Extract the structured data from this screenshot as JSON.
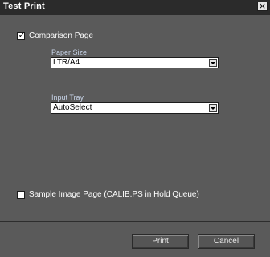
{
  "window": {
    "title": "Test Print",
    "close_glyph": "×"
  },
  "comparison_page": {
    "label": "Comparison Page",
    "checked": true
  },
  "paper_size": {
    "label": "Paper Size",
    "value": "LTR/A4"
  },
  "input_tray": {
    "label": "Input Tray",
    "value": "AutoSelect"
  },
  "sample_image_page": {
    "label": "Sample Image Page (CALIB.PS in Hold Queue)",
    "checked": false
  },
  "buttons": {
    "print": "Print",
    "cancel": "Cancel"
  },
  "icons": {
    "close": "close-icon",
    "dropdown": "chevron-down-icon",
    "check": "checkmark-icon"
  },
  "colors": {
    "background": "#5a5a5a",
    "titlebar": "#2b2b2b",
    "field_label": "#c6d2e6"
  }
}
